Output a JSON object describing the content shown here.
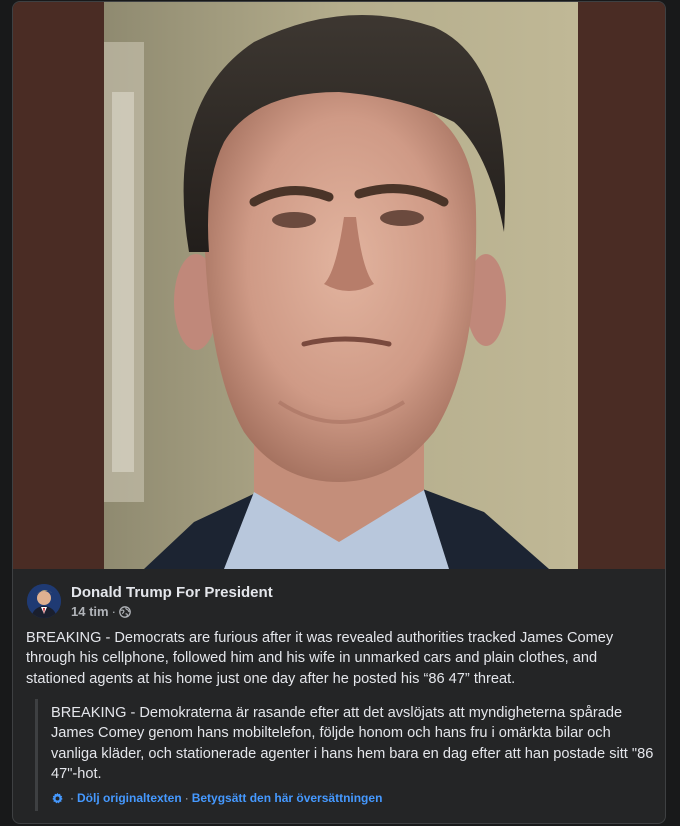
{
  "post": {
    "author": "Donald Trump For President",
    "time": "14 tim",
    "separator": "·",
    "privacy_icon": "globe-icon",
    "text": "BREAKING - Democrats are furious after it was revealed authorities tracked James Comey through his cellphone, followed him and his wife in unmarked cars and plain clothes, and stationed agents at his home just one day after he posted his “86 47” threat."
  },
  "translation": {
    "text": "BREAKING - Demokraterna är rasande efter att det avslöjats att myndigheterna spårade James Comey genom hans mobiltelefon, följde honom och hans fru i omärkta bilar och vanliga kläder, och stationerade agenter i hans hem bara en dag efter att han postade sitt \"86 47\"-hot.",
    "settings_icon": "gear-icon",
    "hide_original_label": "Dölj originaltexten",
    "rate_label": "Betygsätt den här översättningen",
    "separator": "·"
  },
  "colors": {
    "background": "#18191a",
    "card": "#242526",
    "media_backdrop": "#4a2c24",
    "text_primary": "#e4e6eb",
    "text_secondary": "#b0b3b8",
    "link": "#4599ff"
  }
}
